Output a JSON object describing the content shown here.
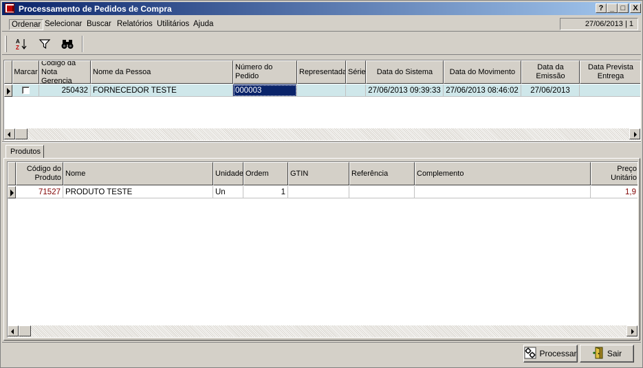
{
  "window": {
    "title": "Processamento de Pedidos de Compra",
    "buttons": [
      "?",
      "_",
      "□",
      "X"
    ]
  },
  "menu": {
    "items": [
      "Ordenar",
      "Selecionar",
      "Buscar",
      "Relatórios",
      "Utilitários",
      "Ajuda"
    ],
    "date_status": "27/06/2013 | 1"
  },
  "toolbar": {
    "tools": [
      "sort-az-icon",
      "filter-icon",
      "binoculars-icon"
    ]
  },
  "orders_grid": {
    "columns": [
      "Marcar",
      "Código da Nota Gerencia",
      "Nome da Pessoa",
      "Número do Pedido",
      "Representada",
      "Série",
      "Data do Sistema",
      "Data do Movimento",
      "Data da Emissão",
      "Data Prevista Entrega"
    ],
    "rows": [
      {
        "marcar": "",
        "codigo_nota": "250432",
        "nome_pessoa": "FORNECEDOR TESTE",
        "numero_pedido": "000003",
        "representada": "",
        "serie": "",
        "data_sistema": "27/06/2013 09:39:33",
        "data_movimento": "27/06/2013 08:46:02",
        "data_emissao": "27/06/2013",
        "data_prevista": ""
      }
    ]
  },
  "tabs": [
    "Produtos"
  ],
  "products_grid": {
    "columns": [
      "Código do Produto",
      "Nome",
      "Unidade",
      "Ordem",
      "GTIN",
      "Referência",
      "Complemento",
      "Preço Unitário"
    ],
    "rows": [
      {
        "codigo": "71527",
        "nome": "PRODUTO TESTE",
        "unidade": "Un",
        "ordem": "1",
        "gtin": "",
        "referencia": "",
        "complemento": "",
        "preco": "1,9"
      }
    ]
  },
  "actions": {
    "processar": "Processar",
    "sair": "Sair"
  },
  "colors": {
    "title_start": "#0a246a",
    "title_end": "#a6caf0",
    "row_selected": "#cfe7ea",
    "cell_focus": "#0a246a",
    "product_code": "#800000"
  }
}
